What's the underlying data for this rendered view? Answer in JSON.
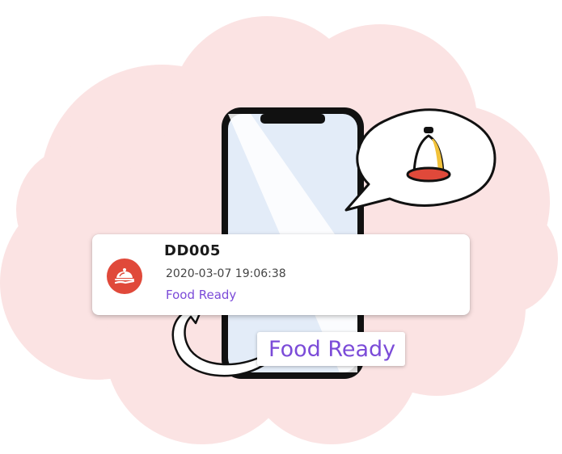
{
  "notification": {
    "order_id": "DD005",
    "timestamp": "2020-03-07 19:06:38",
    "status": "Food Ready",
    "icon": "serving-cloche-icon"
  },
  "callout": {
    "label": "Food Ready"
  },
  "decorations": {
    "phone": "smartphone",
    "speech_bubble_icon": "bell-icon",
    "arrow": "curved-arrow"
  },
  "colors": {
    "cloud": "#fbe3e3",
    "accent_red": "#e0493a",
    "status_purple": "#7b4bd8",
    "bell_yellow": "#f2c23a",
    "phone_screen": "#e3ecf8"
  }
}
